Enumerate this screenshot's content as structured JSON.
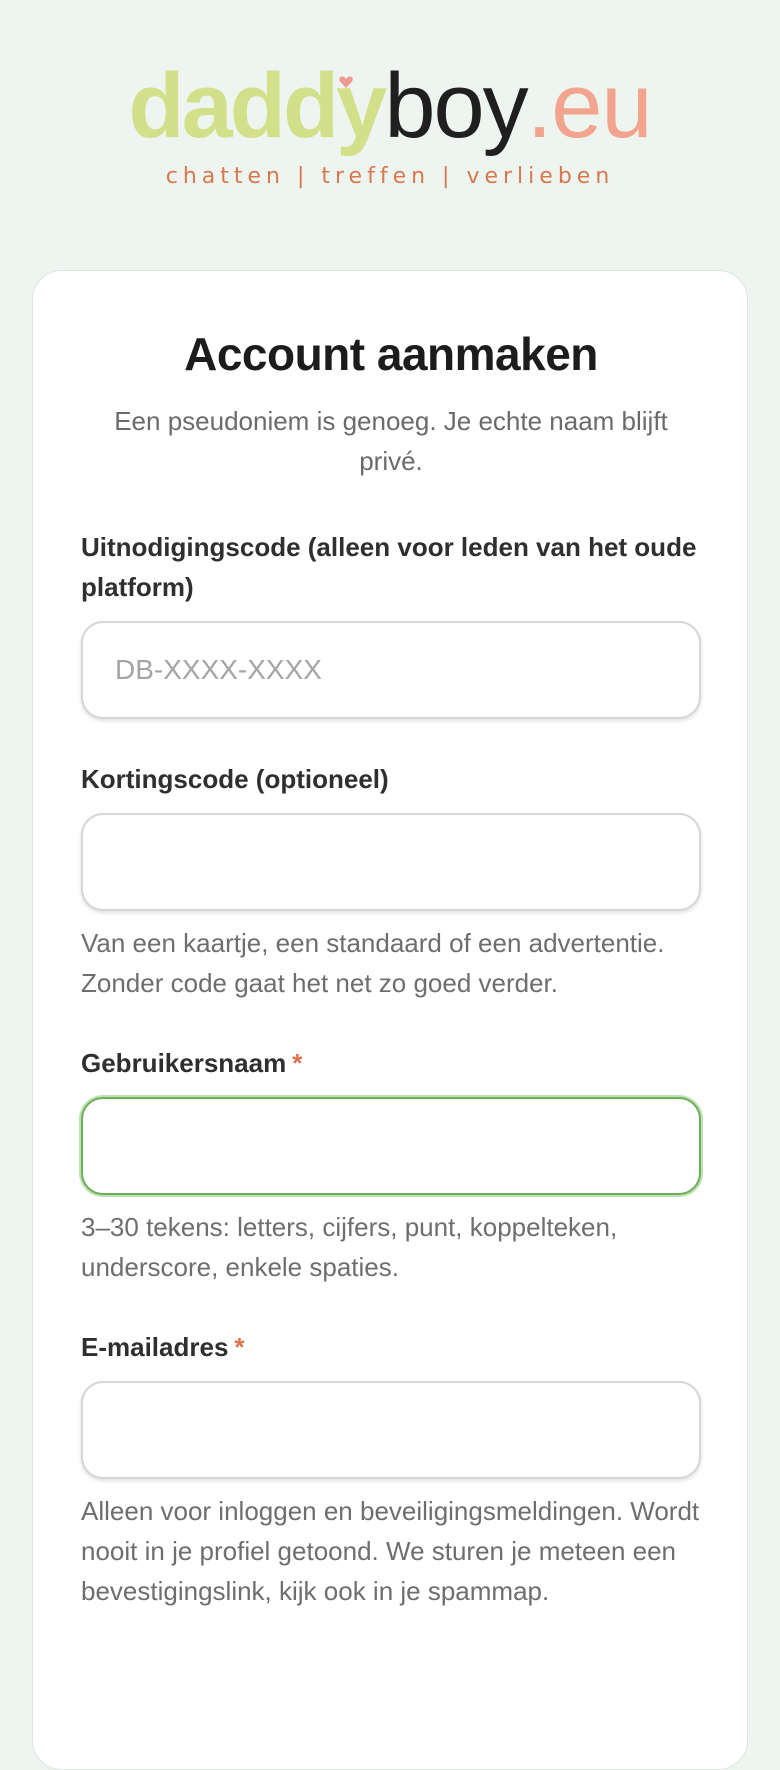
{
  "brand": {
    "part1": "daddy",
    "part2": "boy",
    "part3": ".eu",
    "tagline": "chatten | treffen | verlieben",
    "colors": {
      "daddy": "#d3e08a",
      "boy": "#1f1f1f",
      "eu": "#f2a48e",
      "tagline": "#d9784d"
    }
  },
  "form": {
    "title": "Account aanmaken",
    "subtitle": "Een pseudoniem is genoeg. Je echte naam blijft privé.",
    "invite": {
      "label": "Uitnodigingscode (alleen voor leden van het oude platform)",
      "placeholder": "DB-XXXX-XXXX",
      "value": ""
    },
    "discount": {
      "label": "Kortingscode (optioneel)",
      "value": "",
      "help": "Van een kaartje, een standaard of een advertentie. Zonder code gaat het net zo goed verder."
    },
    "username": {
      "label": "Gebruikersnaam",
      "required_mark": "*",
      "value": "",
      "help": "3–30 tekens: letters, cijfers, punt, koppelteken, underscore, enkele spaties."
    },
    "email": {
      "label": "E-mailadres",
      "required_mark": "*",
      "value": "",
      "help": "Alleen voor inloggen en beveiligingsmeldingen. Wordt nooit in je profiel getoond. We sturen je meteen een bevestigingslink, kijk ook in je spammap."
    }
  },
  "colors": {
    "background": "#eef5f1",
    "focus": "#6cae5a",
    "required": "#e0724a"
  }
}
